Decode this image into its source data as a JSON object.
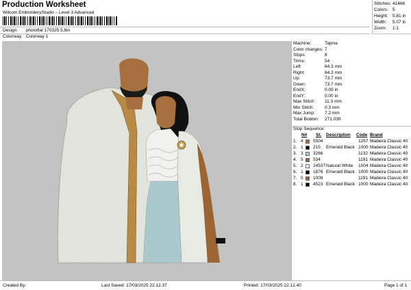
{
  "header": {
    "title": "Production Worksheet",
    "subtitle": "Wilcom EmbroideryStudio – Level 3 Advanced",
    "design_label": "Design:",
    "design_value": "photoflat 170325 5,8in",
    "colorway_label": "Colorway:",
    "colorway_value": "Colorway 1"
  },
  "stats": [
    {
      "label": "Stitches:",
      "value": "41466"
    },
    {
      "label": "Colors:",
      "value": "5"
    },
    {
      "label": "Height:",
      "value": "5.81 in"
    },
    {
      "label": "Width:",
      "value": "5.07 in"
    },
    {
      "label": "Zoom:",
      "value": "1:1"
    }
  ],
  "properties": [
    {
      "label": "Machine:",
      "value": "Tajima"
    },
    {
      "label": "Color changes:",
      "value": "7"
    },
    {
      "label": "Stops:",
      "value": "8"
    },
    {
      "label": "Trims:",
      "value": "54"
    },
    {
      "label": "Left:",
      "value": "64.3 mm"
    },
    {
      "label": "Right:",
      "value": "64.3 mm"
    },
    {
      "label": "Up:",
      "value": "73.7 mm"
    },
    {
      "label": "Down:",
      "value": "73.7 mm"
    },
    {
      "label": "EndX:",
      "value": "0.00 in"
    },
    {
      "label": "EndY:",
      "value": "0.00 in"
    },
    {
      "label": "Max Stitch:",
      "value": "11.3 mm"
    },
    {
      "label": "Min Stitch:",
      "value": "0.3 mm"
    },
    {
      "label": "Max Jump:",
      "value": "7.2 mm"
    },
    {
      "label": "Total Bobbin:",
      "value": "271.03ft"
    }
  ],
  "stop_sequence": {
    "title": "Stop Sequence:",
    "columns": {
      "n": "N#",
      "st": "St.",
      "desc": "Description",
      "code": "Code",
      "brand": "Brand"
    },
    "rows": [
      {
        "stop": "1.",
        "n": "4",
        "color": "#a66f3e",
        "st": "5504",
        "desc": "",
        "code": "1257",
        "brand": "Madeira Classic 40"
      },
      {
        "stop": "2.",
        "n": "1",
        "color": "#000000",
        "st": "215",
        "desc": "Emerald Black",
        "code": "1000",
        "brand": "Madeira Classic 40"
      },
      {
        "stop": "3.",
        "n": "3",
        "color": "#a9c9cc",
        "st": "3266",
        "desc": "",
        "code": "1132",
        "brand": "Madeira Classic 40"
      },
      {
        "stop": "4.",
        "n": "5",
        "color": "#9a6433",
        "st": "534",
        "desc": "",
        "code": "1191",
        "brand": "Madeira Classic 40"
      },
      {
        "stop": "5.",
        "n": "2",
        "color": "#ffffff",
        "st": "24537",
        "desc": "Natural White",
        "code": "1004",
        "brand": "Madeira Classic 40"
      },
      {
        "stop": "6.",
        "n": "1",
        "color": "#000000",
        "st": "1876",
        "desc": "Emerald Black",
        "code": "1000",
        "brand": "Madeira Classic 40"
      },
      {
        "stop": "7.",
        "n": "5",
        "color": "#9a6433",
        "st": "1009",
        "desc": "",
        "code": "1191",
        "brand": "Madeira Classic 40"
      },
      {
        "stop": "8.",
        "n": "1",
        "color": "#000000",
        "st": "4523",
        "desc": "Emerald Black",
        "code": "1000",
        "brand": "Madeira Classic 40"
      }
    ]
  },
  "footer": {
    "created_by": "Created By:",
    "last_saved": "Last Saved: 17/03/2025 22.12.37",
    "printed": "Printed: 17/03/2025 22.12.40",
    "page": "Page 1 of 1"
  },
  "colors": {
    "canvas": "#c3c3c3",
    "skin": "#a66f3e",
    "fabric_white": "#e4e6de",
    "dress_blue": "#a9c9cc",
    "hair": "#111111"
  }
}
